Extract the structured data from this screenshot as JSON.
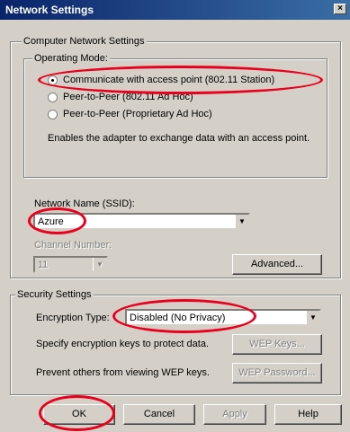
{
  "window": {
    "title": "Network Settings",
    "close_glyph": "×"
  },
  "computer_group": {
    "legend": "Computer Network Settings"
  },
  "operating_mode": {
    "legend": "Operating Mode:",
    "options": [
      {
        "label": "Communicate with access point (802.11 Station)",
        "selected": true
      },
      {
        "label": "Peer-to-Peer (802.11 Ad Hoc)",
        "selected": false
      },
      {
        "label": "Peer-to-Peer (Proprietary Ad Hoc)",
        "selected": false
      }
    ],
    "description": "Enables the adapter to exchange data with an access point."
  },
  "network_name": {
    "label": "Network Name (SSID):",
    "value": "Azure"
  },
  "channel": {
    "label": "Channel Number:",
    "value": "11"
  },
  "advanced_button": "Advanced...",
  "security": {
    "legend": "Security Settings",
    "encryption_label": "Encryption Type:",
    "encryption_value": "Disabled (No Privacy)",
    "keys_text": "Specify encryption keys to protect data.",
    "wep_keys_button": "WEP Keys...",
    "prevent_text": "Prevent others from viewing WEP keys.",
    "wep_password_button": "WEP Password..."
  },
  "buttons": {
    "ok": "OK",
    "cancel": "Cancel",
    "apply": "Apply",
    "help": "Help"
  },
  "colors": {
    "titlebar": "#0a246a",
    "dialog_bg": "#d4d0c8",
    "highlight_ellipse": "#e8001c"
  }
}
